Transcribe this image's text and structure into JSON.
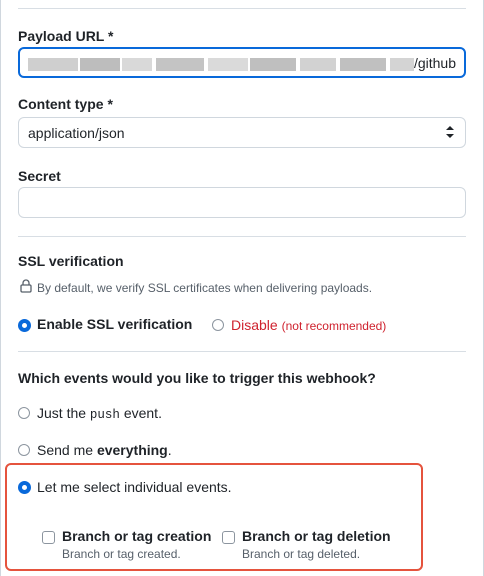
{
  "payload_url": {
    "label": "Payload URL *",
    "visible_suffix": "/github"
  },
  "content_type": {
    "label": "Content type *",
    "value": "application/json"
  },
  "secret": {
    "label": "Secret",
    "value": ""
  },
  "ssl": {
    "heading": "SSL verification",
    "note": "By default, we verify SSL certificates when delivering payloads.",
    "enable_label": "Enable SSL verification",
    "disable_label": "Disable",
    "disable_note": "(not recommended)",
    "selected": "enable"
  },
  "events": {
    "question": "Which events would you like to trigger this webhook?",
    "push_prefix": "Just the ",
    "push_code": "push",
    "push_suffix": " event.",
    "everything_prefix": "Send me ",
    "everything_bold": "everything",
    "everything_suffix": ".",
    "individual_label": "Let me select individual events.",
    "selected": "individual",
    "individual_options": [
      {
        "title": "Branch or tag creation",
        "desc": "Branch or tag created.",
        "checked": false
      },
      {
        "title": "Branch or tag deletion",
        "desc": "Branch or tag deleted.",
        "checked": false
      }
    ]
  },
  "colors": {
    "accent": "#0969da",
    "danger": "#cf222e",
    "highlight": "#e5533d"
  },
  "icons": {
    "ssl_note": "lock-icon",
    "select_caret": "up-down-caret-icon"
  }
}
